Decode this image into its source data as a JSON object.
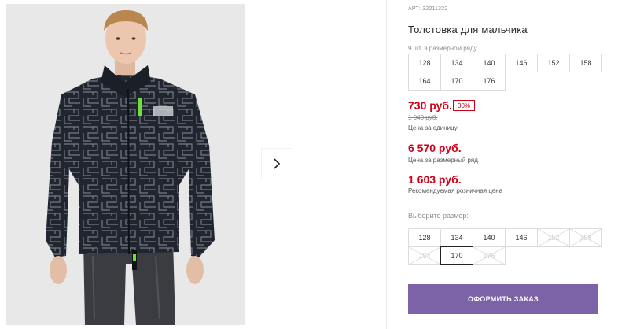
{
  "gallery": {
    "next_icon": "chevron-right-icon"
  },
  "product": {
    "article": "АРТ: 32211322",
    "title": "Толстовка для мальчика",
    "set_note": "9 шт. в размерном ряду",
    "set_sizes": [
      "128",
      "134",
      "140",
      "146",
      "152",
      "158",
      "164",
      "170",
      "176"
    ],
    "price": "730 руб.",
    "discount": "30%",
    "old_price": "1 040 руб.",
    "price_unit_label": "Цена за единицу",
    "price_set": "6 570 руб.",
    "price_set_label": "Цена за размерный ряд",
    "price_retail": "1 603 руб.",
    "price_retail_label": "Рекомендуемая розничная цена",
    "size_prompt": "Выберите размер:",
    "sizes": [
      {
        "label": "128",
        "available": true,
        "selected": false
      },
      {
        "label": "134",
        "available": true,
        "selected": false
      },
      {
        "label": "140",
        "available": true,
        "selected": false
      },
      {
        "label": "146",
        "available": true,
        "selected": false
      },
      {
        "label": "152",
        "available": false,
        "selected": false
      },
      {
        "label": "158",
        "available": false,
        "selected": false
      },
      {
        "label": "164",
        "available": false,
        "selected": false
      },
      {
        "label": "170",
        "available": true,
        "selected": true
      },
      {
        "label": "176",
        "available": false,
        "selected": false
      }
    ],
    "order_button": "ОФОРМИТЬ ЗАКАЗ"
  },
  "colors": {
    "accent_red": "#d0021b",
    "order_button": "#7c63a8"
  }
}
